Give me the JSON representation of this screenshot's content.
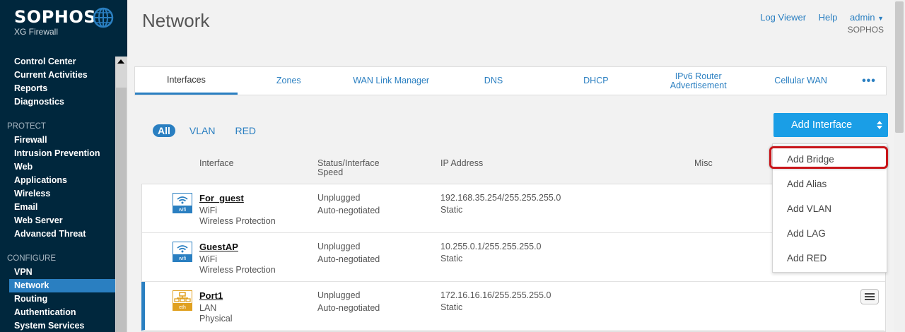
{
  "brand": {
    "name": "SOPHOS",
    "product": "XG Firewall"
  },
  "sidebar": {
    "top_items": [
      {
        "label": "Control Center"
      },
      {
        "label": "Current Activities"
      },
      {
        "label": "Reports"
      },
      {
        "label": "Diagnostics"
      }
    ],
    "protect_title": "PROTECT",
    "protect_items": [
      {
        "label": "Firewall"
      },
      {
        "label": "Intrusion Prevention"
      },
      {
        "label": "Web"
      },
      {
        "label": "Applications"
      },
      {
        "label": "Wireless"
      },
      {
        "label": "Email"
      },
      {
        "label": "Web Server"
      },
      {
        "label": "Advanced Threat"
      }
    ],
    "configure_title": "CONFIGURE",
    "configure_items": [
      {
        "label": "VPN"
      },
      {
        "label": "Network",
        "active": true
      },
      {
        "label": "Routing"
      },
      {
        "label": "Authentication"
      },
      {
        "label": "System Services"
      }
    ]
  },
  "header": {
    "title": "Network",
    "links": [
      "Log Viewer",
      "Help"
    ],
    "user": "admin",
    "user_org": "SOPHOS"
  },
  "tabs": [
    {
      "label": "Interfaces",
      "active": true
    },
    {
      "label": "Zones"
    },
    {
      "label": "WAN Link Manager"
    },
    {
      "label": "DNS"
    },
    {
      "label": "DHCP"
    },
    {
      "label": "IPv6 Router Advertisement"
    },
    {
      "label": "Cellular WAN"
    },
    {
      "label": "•••"
    }
  ],
  "filters": [
    {
      "label": "All",
      "active": true
    },
    {
      "label": "VLAN"
    },
    {
      "label": "RED"
    }
  ],
  "add_interface": {
    "label": "Add Interface",
    "options": [
      "Add Bridge",
      "Add Alias",
      "Add VLAN",
      "Add LAG",
      "Add RED"
    ],
    "highlighted": "Add Bridge"
  },
  "table": {
    "columns": {
      "interface": "Interface",
      "status": "Status/Interface Speed",
      "ip": "IP Address",
      "misc": "Misc"
    },
    "rows": [
      {
        "name": "For_guest",
        "type": "WiFi",
        "zone": "Wireless Protection",
        "status": "Unplugged",
        "speed": "Auto-negotiated",
        "ip": "192.168.35.254/255.255.255.0",
        "mode": "Static",
        "icon": "wifi",
        "icon_label": "wifi"
      },
      {
        "name": "GuestAP",
        "type": "WiFi",
        "zone": "Wireless Protection",
        "status": "Unplugged",
        "speed": "Auto-negotiated",
        "ip": "10.255.0.1/255.255.255.0",
        "mode": "Static",
        "icon": "wifi",
        "icon_label": "wifi"
      },
      {
        "name": "Port1",
        "type": "LAN",
        "zone": "Physical",
        "status": "Unplugged",
        "speed": "Auto-negotiated",
        "ip": "172.16.16.16/255.255.255.0",
        "mode": "Static",
        "icon": "ethernet",
        "icon_label": "eth"
      }
    ]
  },
  "colors": {
    "sidebar_bg": "#00273d",
    "accent": "#2a7fc1",
    "button": "#1a9ee6",
    "highlight": "#c8151a",
    "eth_icon": "#e0a020"
  }
}
